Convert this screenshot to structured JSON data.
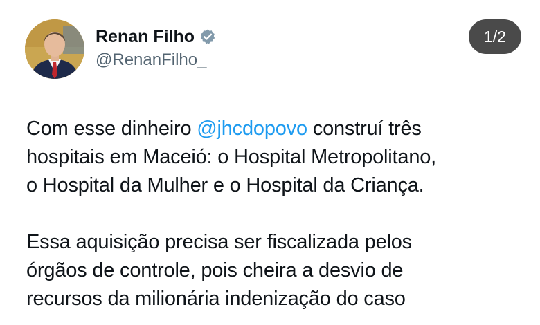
{
  "author": {
    "display_name": "Renan Filho",
    "handle": "@RenanFilho_",
    "verified": true,
    "avatar_icon": "profile-photo"
  },
  "thread": {
    "position": "1/2"
  },
  "post": {
    "paragraphs": [
      {
        "before_mention": "Com esse dinheiro ",
        "mention": "@jhcdopovo",
        "line1_rest": " construí três",
        "line2": "hospitais em Maceió: o Hospital Metropolitano,",
        "line3": "o Hospital da Mulher e o Hospital da Criança."
      },
      {
        "line1": "Essa aquisição precisa ser fiscalizada pelos",
        "line2": "órgãos de controle, pois cheira a desvio de",
        "line3": "recursos da milionária indenização do caso"
      }
    ]
  },
  "colors": {
    "mention": "#1d9bf0",
    "verified_badge": "#829aab",
    "handle": "#536471",
    "badge_bg": "#4a4a4a"
  }
}
